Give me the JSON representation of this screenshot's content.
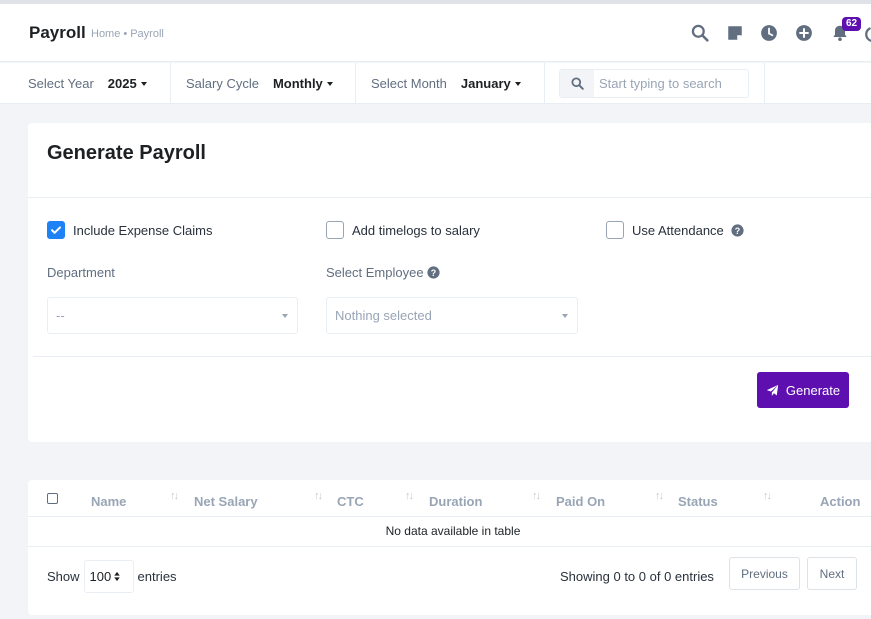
{
  "header": {
    "title": "Payroll",
    "breadcrumb": [
      "Home",
      "Payroll"
    ],
    "breadcrumb_sep": "•",
    "notification_count": "62"
  },
  "filters": {
    "year_label": "Select Year",
    "year_value": "2025",
    "cycle_label": "Salary Cycle",
    "cycle_value": "Monthly",
    "month_label": "Select Month",
    "month_value": "January",
    "search_placeholder": "Start typing to search"
  },
  "generate": {
    "title": "Generate Payroll",
    "include_expense_claims": "Include Expense Claims",
    "include_expense_checked": true,
    "add_timelogs": "Add timelogs to salary",
    "use_attendance": "Use Attendance",
    "department_label": "Department",
    "department_value": "--",
    "employee_label": "Select Employee",
    "employee_value": "Nothing selected",
    "button_label": "Generate"
  },
  "table": {
    "columns": [
      "Name",
      "Net Salary",
      "CTC",
      "Duration",
      "Paid On",
      "Status",
      "Action"
    ],
    "empty_message": "No data available in table",
    "show_label": "Show",
    "entries_value": "100",
    "entries_label": "entries",
    "info": "Showing 0 to 0 of 0 entries",
    "previous": "Previous",
    "next": "Next"
  },
  "colors": {
    "accent": "#5e0fb0",
    "checkbox": "#1d82f5"
  }
}
